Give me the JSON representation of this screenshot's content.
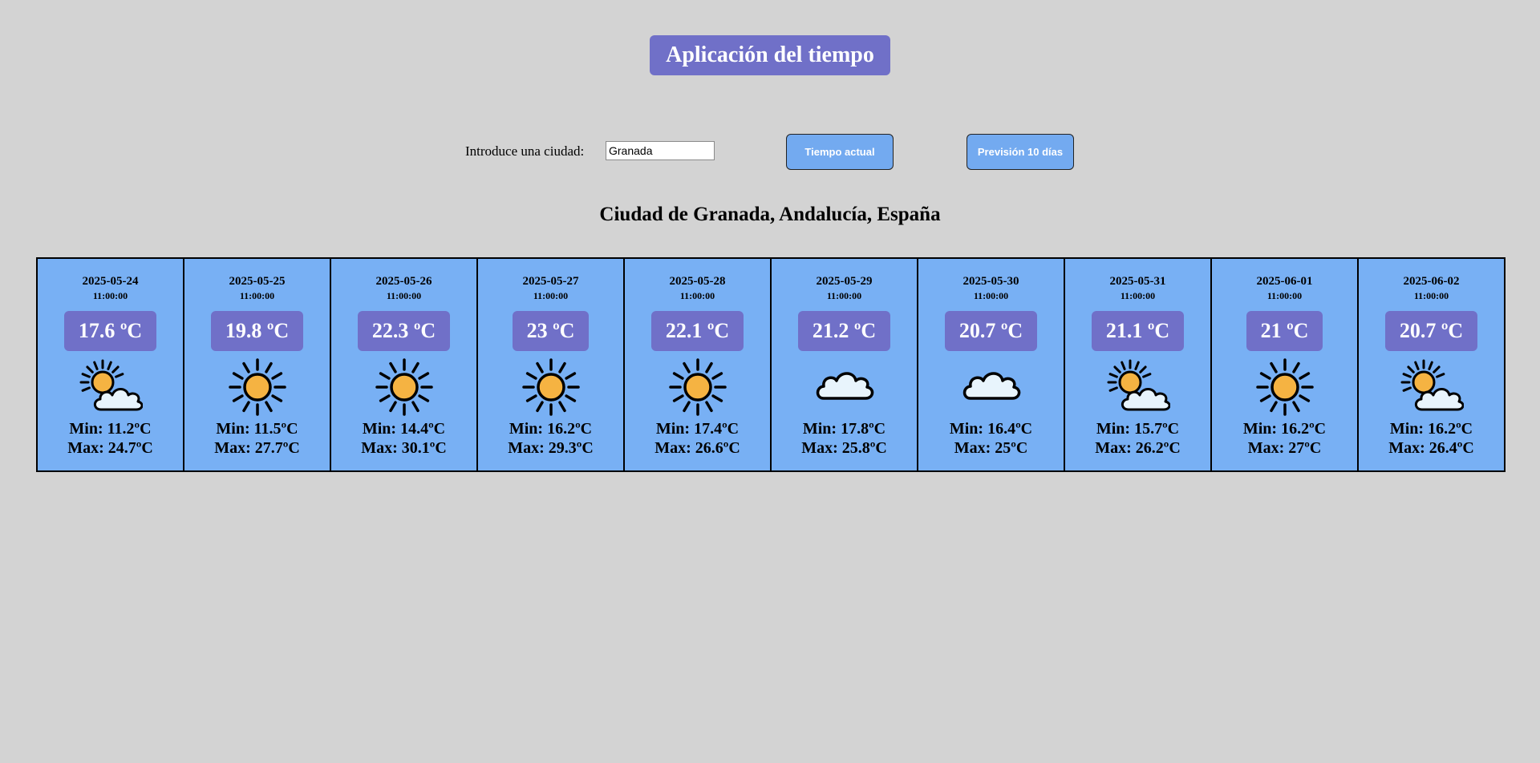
{
  "app": {
    "title": "Aplicación del tiempo"
  },
  "search": {
    "label": "Introduce una ciudad:",
    "value": "Granada",
    "current_button": "Tiempo actual",
    "forecast_button": "Previsión 10 días"
  },
  "location": {
    "heading": "Ciudad de Granada, Andalucía, España"
  },
  "colors": {
    "background": "#d3d3d3",
    "accent_purple": "#7070c8",
    "card_blue": "#78b0f4",
    "button_blue": "#73aaf0"
  },
  "forecast": [
    {
      "date": "2025-05-24",
      "time": "11:00:00",
      "temp": "17.6 ºC",
      "icon": "partly-cloudy-icon",
      "min": "Min: 11.2ºC",
      "max": "Max: 24.7ºC"
    },
    {
      "date": "2025-05-25",
      "time": "11:00:00",
      "temp": "19.8 ºC",
      "icon": "sun-icon",
      "min": "Min: 11.5ºC",
      "max": "Max: 27.7ºC"
    },
    {
      "date": "2025-05-26",
      "time": "11:00:00",
      "temp": "22.3 ºC",
      "icon": "sun-icon",
      "min": "Min: 14.4ºC",
      "max": "Max: 30.1ºC"
    },
    {
      "date": "2025-05-27",
      "time": "11:00:00",
      "temp": "23 ºC",
      "icon": "sun-icon",
      "min": "Min: 16.2ºC",
      "max": "Max: 29.3ºC"
    },
    {
      "date": "2025-05-28",
      "time": "11:00:00",
      "temp": "22.1 ºC",
      "icon": "sun-icon",
      "min": "Min: 17.4ºC",
      "max": "Max: 26.6ºC"
    },
    {
      "date": "2025-05-29",
      "time": "11:00:00",
      "temp": "21.2 ºC",
      "icon": "cloud-icon",
      "min": "Min: 17.8ºC",
      "max": "Max: 25.8ºC"
    },
    {
      "date": "2025-05-30",
      "time": "11:00:00",
      "temp": "20.7 ºC",
      "icon": "cloud-icon",
      "min": "Min: 16.4ºC",
      "max": "Max: 25ºC"
    },
    {
      "date": "2025-05-31",
      "time": "11:00:00",
      "temp": "21.1 ºC",
      "icon": "partly-cloudy-icon",
      "min": "Min: 15.7ºC",
      "max": "Max: 26.2ºC"
    },
    {
      "date": "2025-06-01",
      "time": "11:00:00",
      "temp": "21 ºC",
      "icon": "sun-icon",
      "min": "Min: 16.2ºC",
      "max": "Max: 27ºC"
    },
    {
      "date": "2025-06-02",
      "time": "11:00:00",
      "temp": "20.7 ºC",
      "icon": "partly-cloudy-icon",
      "min": "Min: 16.2ºC",
      "max": "Max: 26.4ºC"
    }
  ]
}
